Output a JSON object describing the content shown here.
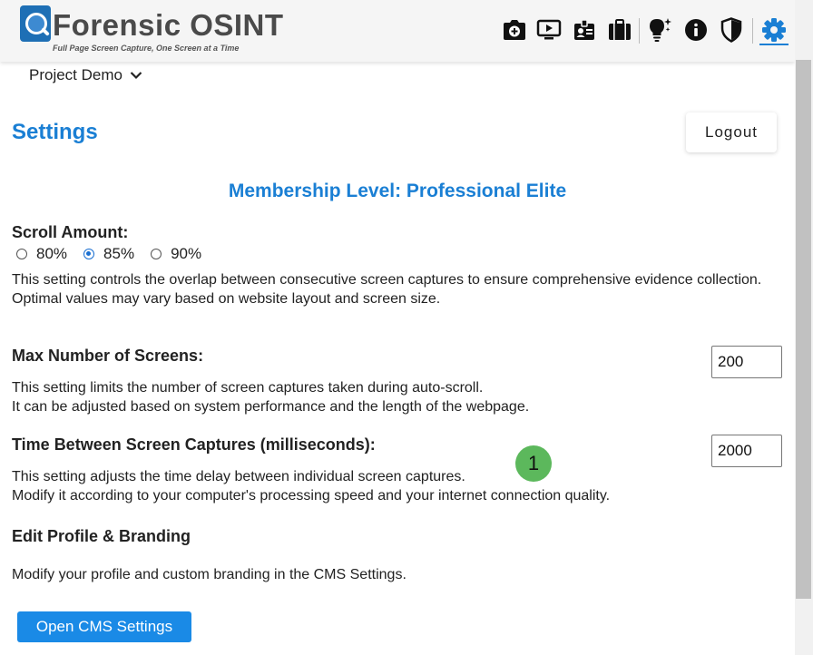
{
  "header": {
    "logo_title": "Forensic OSINT",
    "logo_tagline": "Full Page Screen Capture, One Screen at a Time",
    "toolbar_icons": [
      "camera-plus-icon",
      "video-play-icon",
      "id-badge-icon",
      "briefcase-icon",
      "lightbulb-sparkle-icon",
      "info-icon",
      "shield-icon",
      "gear-icon"
    ],
    "active_icon": "gear-icon",
    "accent_color": "#1a7fd4"
  },
  "project": {
    "name": "Project Demo"
  },
  "page": {
    "title": "Settings",
    "logout_label": "Logout",
    "membership": "Membership Level: Professional Elite"
  },
  "scroll_amount": {
    "title": "Scroll Amount:",
    "options": [
      "80%",
      "85%",
      "90%"
    ],
    "selected": "85%",
    "desc_line1": "This setting controls the overlap between consecutive screen captures to ensure comprehensive evidence collection.",
    "desc_line2": "Optimal values may vary based on website layout and screen size."
  },
  "max_screens": {
    "title": "Max Number of Screens:",
    "value": "200",
    "desc_line1": "This setting limits the number of screen captures taken during auto-scroll.",
    "desc_line2": "It can be adjusted based on system performance and the length of the webpage."
  },
  "time_between": {
    "title": "Time Between Screen Captures (milliseconds):",
    "value": "2000",
    "desc_line1": "This setting adjusts the time delay between individual screen captures.",
    "desc_line2": "Modify it according to your computer's processing speed and your internet connection quality."
  },
  "badge": {
    "number": "1",
    "color": "#5cb85c"
  },
  "profile": {
    "title": "Edit Profile & Branding",
    "desc": "Modify your profile and custom branding in the CMS Settings.",
    "button_label": "Open CMS Settings",
    "button_color": "#1a8ae6"
  }
}
